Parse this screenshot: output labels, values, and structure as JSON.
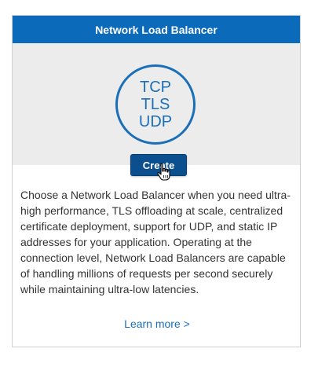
{
  "card": {
    "title": "Network Load Balancer",
    "protocols": [
      "TCP",
      "TLS",
      "UDP"
    ],
    "create_label": "Create",
    "description": "Choose a Network Load Balancer when you need ultra-high performance, TLS offloading at scale, centralized certificate deployment, support for UDP, and static IP addresses for your application. Operating at the connection level, Network Load Balancers are capable of handling millions of requests per second securely while maintaining ultra-low latencies.",
    "learn_more": "Learn more >"
  },
  "icons": {
    "cursor": "hand-pointer-icon"
  },
  "colors": {
    "header": "#0b6ab9",
    "button": "#0b4f8f",
    "accent": "#1a6fb8"
  }
}
